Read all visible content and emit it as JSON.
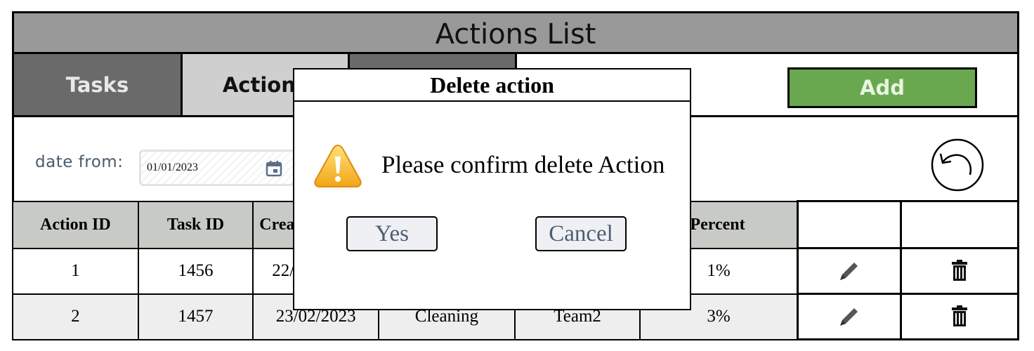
{
  "page": {
    "title": "Actions List"
  },
  "tabs": [
    {
      "label": "Tasks"
    },
    {
      "label": "Actions"
    }
  ],
  "toolbar": {
    "add_label": "Add"
  },
  "filter": {
    "date_from_label": "date from:",
    "date_from_value": "01/01/2023"
  },
  "table": {
    "headers": [
      "Action ID",
      "Task ID",
      "Created",
      "",
      "",
      "Percent",
      "",
      ""
    ],
    "rows": [
      {
        "action_id": "1",
        "task_id": "1456",
        "created": "22/",
        "type": "",
        "team": "",
        "percent": "1%"
      },
      {
        "action_id": "2",
        "task_id": "1457",
        "created": "23/02/2023",
        "type": "Cleaning",
        "team": "Team2",
        "percent": "3%"
      }
    ]
  },
  "dialog": {
    "title": "Delete action",
    "message": "Please confirm delete Action",
    "yes_label": "Yes",
    "cancel_label": "Cancel"
  },
  "colors": {
    "title_bar": "#999999",
    "tab_inactive": "#6a6a6a",
    "tab_active": "#cfcfcf",
    "add_button": "#6aa84f",
    "table_header": "#c8cac6"
  },
  "icons": [
    "calendar-icon",
    "undo-icon",
    "pencil-icon",
    "trash-icon",
    "warning-icon"
  ]
}
